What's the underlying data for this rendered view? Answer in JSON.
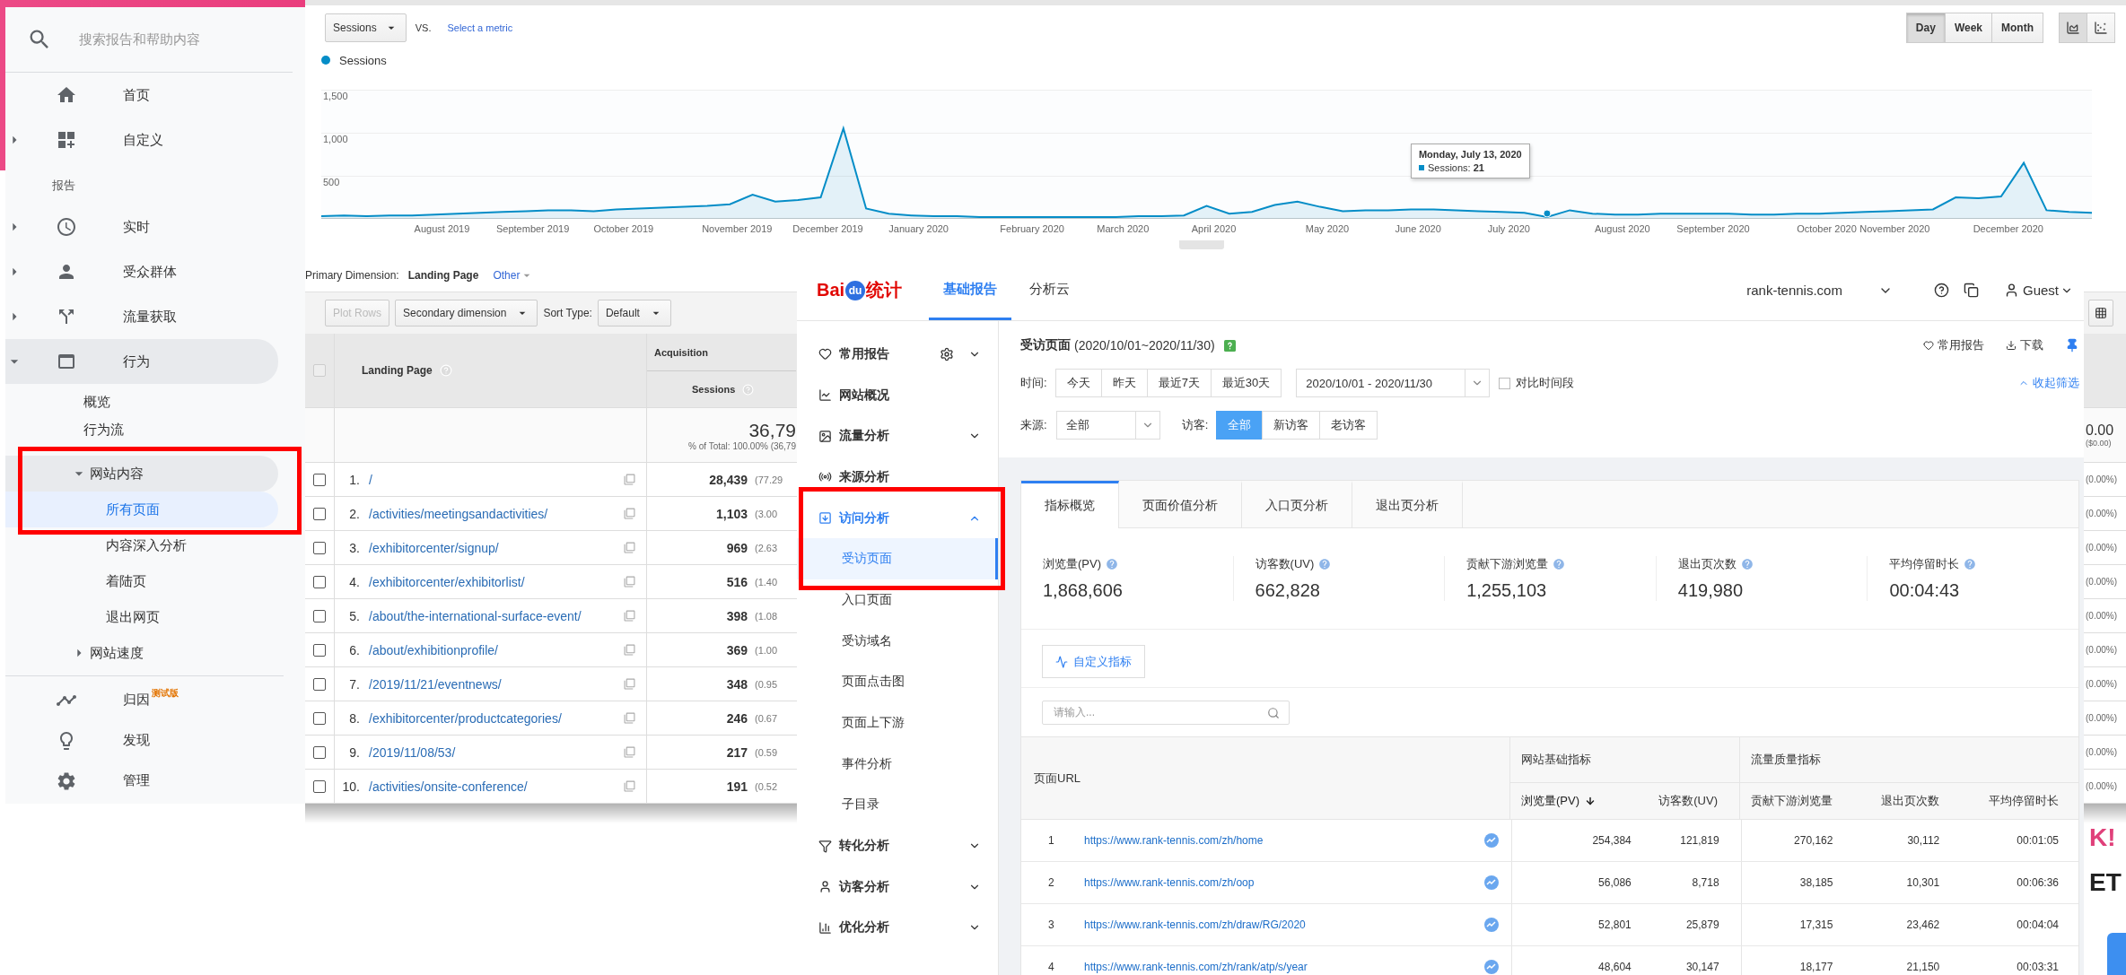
{
  "ga": {
    "sidebar": {
      "search_placeholder": "搜索报告和帮助内容",
      "top_items": [
        {
          "label": "首页"
        },
        {
          "label": "自定义",
          "expanded": false
        }
      ],
      "section_label": "报告",
      "report_items": [
        {
          "label": "实时",
          "expanded": false
        },
        {
          "label": "受众群体",
          "expanded": false
        },
        {
          "label": "流量获取",
          "expanded": false
        },
        {
          "label": "行为",
          "expanded": true,
          "children": [
            {
              "label": "概览",
              "selected": false
            },
            {
              "label": "行为流",
              "selected": false
            },
            {
              "label": "网站内容",
              "selected": false,
              "expanded": true,
              "children": [
                {
                  "label": "所有页面",
                  "selected": true
                },
                {
                  "label": "内容深入分析",
                  "selected": false
                },
                {
                  "label": "着陆页",
                  "selected": false
                },
                {
                  "label": "退出网页",
                  "selected": false
                }
              ]
            },
            {
              "label": "网站速度",
              "selected": false,
              "expanded": false
            }
          ]
        }
      ],
      "bottom_items": [
        {
          "label": "归因",
          "badge": "测试版"
        },
        {
          "label": "发现"
        },
        {
          "label": "管理"
        }
      ]
    },
    "toolbar": {
      "metric": "Sessions",
      "vs_label": "VS.",
      "select_metric": "Select a metric",
      "periods": [
        {
          "label": "Day",
          "selected": true
        },
        {
          "label": "Week",
          "selected": false
        },
        {
          "label": "Month",
          "selected": false
        }
      ],
      "chart_types": [
        {
          "selected": true
        },
        {
          "selected": false
        }
      ]
    },
    "chart_data": {
      "type": "area",
      "categories": [
        null,
        null,
        null,
        null,
        null,
        "August 2019",
        null,
        null,
        null,
        "September 2019",
        null,
        null,
        null,
        "October 2019",
        null,
        null,
        null,
        null,
        "November 2019",
        null,
        null,
        null,
        "December 2019",
        null,
        null,
        null,
        "January 2020",
        null,
        null,
        null,
        null,
        "February 2020",
        null,
        null,
        null,
        "March 2020",
        null,
        null,
        null,
        "April 2020",
        null,
        null,
        null,
        null,
        "May 2020",
        null,
        null,
        null,
        "June 2020",
        null,
        null,
        null,
        "July 2020",
        null,
        null,
        null,
        null,
        "August 2020",
        null,
        null,
        null,
        "September 2020",
        null,
        null,
        null,
        null,
        "October 2020",
        null,
        null,
        "November 2020",
        null,
        null,
        null,
        null,
        "December 2020",
        null,
        null,
        null,
        null
      ],
      "series": [
        {
          "name": "Sessions",
          "color": "#058dc7",
          "values": [
            30,
            40,
            30,
            40,
            40,
            50,
            60,
            70,
            80,
            90,
            100,
            100,
            90,
            110,
            120,
            130,
            140,
            150,
            170,
            280,
            200,
            220,
            250,
            1050,
            120,
            60,
            40,
            30,
            30,
            20,
            20,
            20,
            20,
            20,
            20,
            20,
            30,
            30,
            40,
            150,
            60,
            80,
            160,
            200,
            140,
            90,
            100,
            100,
            110,
            110,
            100,
            90,
            80,
            70,
            21,
            100,
            60,
            50,
            50,
            60,
            60,
            60,
            60,
            50,
            50,
            60,
            60,
            70,
            80,
            90,
            100,
            110,
            250,
            240,
            260,
            650,
            100,
            80,
            70
          ]
        }
      ],
      "ylim": [
        0,
        1500
      ],
      "yticks": [
        {
          "value": 500,
          "label": "500"
        },
        {
          "value": 1000,
          "label": "1,000"
        },
        {
          "value": 1500,
          "label": "1,500"
        }
      ],
      "annotations": [
        "Monday, July 13, 2020",
        "Sessions: **21**"
      ]
    },
    "table": {
      "primary_label": "Primary Dimension:",
      "primary_value": "Landing Page",
      "other": "Other",
      "plot_rows": {
        "label": "Plot Rows",
        "disabled": true
      },
      "secondary_dimension": "Secondary dimension",
      "sort_label": "Sort Type:",
      "sort_value": "Default",
      "select_all_checked": false,
      "landing_header": "Landing Page",
      "group_header": "Acquisition",
      "sessions_header": "Sessions",
      "total": "36,79",
      "total_share": "% of Total: 100.00% (36,79",
      "last_total": "0.00",
      "last_total_share": "($0.00)",
      "rows": [
        {
          "rank": "1.",
          "page": "/",
          "sessions": "28,439",
          "share": "(77.29",
          "last_share": "(0.00%)",
          "checked": false
        },
        {
          "rank": "2.",
          "page": "/activities/meetingsandactivities/",
          "sessions": "1,103",
          "share": "(3.00",
          "last_share": "(0.00%)",
          "checked": false
        },
        {
          "rank": "3.",
          "page": "/exhibitorcenter/signup/",
          "sessions": "969",
          "share": "(2.63",
          "last_share": "(0.00%)",
          "checked": false
        },
        {
          "rank": "4.",
          "page": "/exhibitorcenter/exhibitorlist/",
          "sessions": "516",
          "share": "(1.40",
          "last_share": "(0.00%)",
          "checked": false
        },
        {
          "rank": "5.",
          "page": "/about/the-international-surface-event/",
          "sessions": "398",
          "share": "(1.08",
          "last_share": "(0.00%)",
          "checked": false
        },
        {
          "rank": "6.",
          "page": "/about/exhibitionprofile/",
          "sessions": "369",
          "share": "(1.00",
          "last_share": "(0.00%)",
          "checked": false
        },
        {
          "rank": "7.",
          "page": "/2019/11/21/eventnews/",
          "sessions": "348",
          "share": "(0.95",
          "last_share": "(0.00%)",
          "checked": false
        },
        {
          "rank": "8.",
          "page": "/exhibitorcenter/productcategories/",
          "sessions": "246",
          "share": "(0.67",
          "last_share": "(0.00%)",
          "checked": false
        },
        {
          "rank": "9.",
          "page": "/2019/11/08/53/",
          "sessions": "217",
          "share": "(0.59",
          "last_share": "(0.00%)",
          "checked": false
        },
        {
          "rank": "10.",
          "page": "/activities/onsite-conference/",
          "sessions": "191",
          "share": "(0.52",
          "last_share": "(0.00%)",
          "checked": false
        }
      ]
    }
  },
  "baidu": {
    "logo": {
      "brand": "Bai",
      "mark": "du",
      "suffix": "统计"
    },
    "top_tabs": [
      {
        "label": "基础报告",
        "selected": true
      },
      {
        "label": "分析云",
        "selected": false
      }
    ],
    "site": "rank-tennis.com",
    "user": "Guest",
    "nav": [
      {
        "label": "常用报告",
        "kind": "group",
        "expanded": false
      },
      {
        "label": "网站概况",
        "kind": "link"
      },
      {
        "label": "流量分析",
        "kind": "group",
        "expanded": false
      },
      {
        "label": "来源分析",
        "kind": "link"
      },
      {
        "label": "访问分析",
        "kind": "group",
        "expanded": true,
        "children": [
          {
            "label": "受访页面",
            "selected": true
          },
          {
            "label": "入口页面",
            "selected": false
          },
          {
            "label": "受访域名",
            "selected": false
          },
          {
            "label": "页面点击图",
            "selected": false
          },
          {
            "label": "页面上下游",
            "selected": false
          },
          {
            "label": "事件分析",
            "selected": false
          },
          {
            "label": "子目录",
            "selected": false
          }
        ]
      },
      {
        "label": "转化分析",
        "kind": "group",
        "expanded": false
      },
      {
        "label": "访客分析",
        "kind": "group",
        "expanded": false
      },
      {
        "label": "优化分析",
        "kind": "group",
        "expanded": false
      }
    ],
    "page": {
      "title": "受访页面",
      "range": "(2020/10/01~2020/11/30)",
      "actions": [
        "常用报告",
        "下载"
      ]
    },
    "filters": {
      "time_label": "时间:",
      "quick_ranges": [
        {
          "label": "今天",
          "selected": false
        },
        {
          "label": "昨天",
          "selected": false
        },
        {
          "label": "最近7天",
          "selected": false
        },
        {
          "label": "最近30天",
          "selected": false
        }
      ],
      "date_range": "2020/10/01 - 2020/11/30",
      "compare": {
        "label": "对比时间段",
        "checked": false
      },
      "collapse": "收起筛选",
      "source_label": "来源:",
      "source_value": "全部",
      "visitor_label": "访客:",
      "visitor_options": [
        {
          "label": "全部",
          "selected": true
        },
        {
          "label": "新访客",
          "selected": false
        },
        {
          "label": "老访客",
          "selected": false
        }
      ]
    },
    "report_tabs": [
      {
        "label": "指标概览",
        "selected": true
      },
      {
        "label": "页面价值分析",
        "selected": false
      },
      {
        "label": "入口页分析",
        "selected": false
      },
      {
        "label": "退出页分析",
        "selected": false
      }
    ],
    "metrics": [
      {
        "label": "浏览量(PV)",
        "value": "1,868,606"
      },
      {
        "label": "访客数(UV)",
        "value": "662,828"
      },
      {
        "label": "贡献下游浏览量",
        "value": "1,255,103"
      },
      {
        "label": "退出页次数",
        "value": "419,980"
      },
      {
        "label": "平均停留时长",
        "value": "00:04:43"
      }
    ],
    "custom_metrics": "自定义指标",
    "search_placeholder": "请输入...",
    "table": {
      "url_header": "页面URL",
      "column_groups": [
        {
          "label": "网站基础指标",
          "columns": [
            {
              "label": "浏览量(PV)",
              "sorted": true
            },
            {
              "label": "访客数(UV)",
              "sorted": false
            }
          ]
        },
        {
          "label": "流量质量指标",
          "columns": [
            {
              "label": "贡献下游浏览量",
              "sorted": false
            },
            {
              "label": "退出页次数",
              "sorted": false
            },
            {
              "label": "平均停留时长",
              "sorted": false
            }
          ]
        }
      ],
      "rows": [
        {
          "index": "1",
          "url": "https://www.rank-tennis.com/zh/home",
          "values": [
            "254,384",
            "121,819",
            "270,162",
            "30,112",
            "00:01:05"
          ]
        },
        {
          "index": "2",
          "url": "https://www.rank-tennis.com/zh/oop",
          "values": [
            "56,086",
            "8,718",
            "38,185",
            "10,301",
            "00:06:36"
          ]
        },
        {
          "index": "3",
          "url": "https://www.rank-tennis.com/zh/draw/RG/2020",
          "values": [
            "52,801",
            "25,879",
            "17,315",
            "23,462",
            "00:04:04"
          ]
        },
        {
          "index": "4",
          "url": "https://www.rank-tennis.com/zh/rank/atp/s/year",
          "values": [
            "48,604",
            "30,147",
            "18,177",
            "21,150",
            "00:03:31"
          ]
        }
      ]
    }
  },
  "background_fragments": [
    "K!",
    "ET"
  ]
}
